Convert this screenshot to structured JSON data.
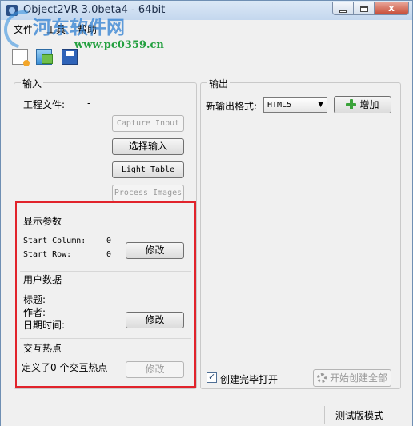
{
  "window": {
    "title": "Object2VR 3.0beta4 - 64bit",
    "close_glyph": "x"
  },
  "watermark": {
    "text": "河东软件网",
    "url": "www.pc0359.cn"
  },
  "menu": [
    "文件",
    "工具",
    "帮助"
  ],
  "toolbar": {
    "icons": [
      "new-project-icon",
      "open-icon",
      "save-icon"
    ]
  },
  "input": {
    "group_label": "输入",
    "project_label": "工程文件:",
    "project_value": "-",
    "capture_input": "Capture Input",
    "select_input": "选择输入",
    "light_table": "Light Table",
    "process_images": "Process Images"
  },
  "display_params": {
    "heading": "显示参数",
    "start_column_label": "Start Column:",
    "start_column_value": "0",
    "start_row_label": "Start Row:",
    "start_row_value": "0",
    "modify": "修改"
  },
  "user_data": {
    "heading": "用户数据",
    "title_label": "标题:",
    "author_label": "作者:",
    "datetime_label": "日期时间:",
    "modify": "修改"
  },
  "hotspots": {
    "heading": "交互热点",
    "summary": "定义了0 个交互热点",
    "modify": "修改"
  },
  "output": {
    "group_label": "输出",
    "format_label": "新输出格式:",
    "format_value": "HTML5",
    "add": "增加",
    "open_after_create": "创建完毕打开",
    "open_after_create_checked": true,
    "create_all": "开始创建全部"
  },
  "status": {
    "mode": "测试版模式"
  },
  "colors": {
    "highlight_box": "#e1232b",
    "watermark_blue": "#2e7fd2",
    "watermark_green": "#24a040"
  }
}
